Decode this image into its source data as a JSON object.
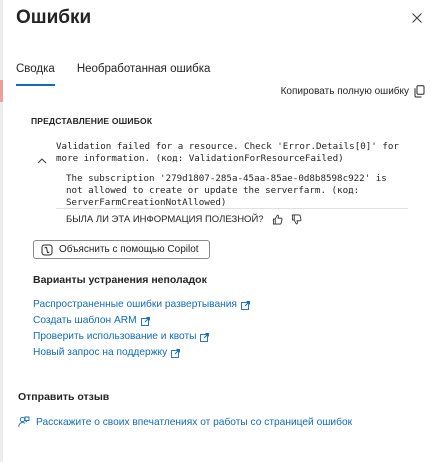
{
  "header": {
    "title": "Ошибки"
  },
  "tabs": [
    {
      "label": "Сводка",
      "active": true
    },
    {
      "label": "Необработанная ошибка",
      "active": false
    }
  ],
  "copy": {
    "label": "Копировать полную ошибку"
  },
  "error_section": {
    "heading": "ПРЕДСТАВЛЕНИЕ ОШИБОК",
    "main_message": "Validation failed for a resource. Check 'Error.Details[0]' for more information. (код: ValidationForResourceFailed)",
    "detail_message": "The subscription '279d1807-285a-45aa-85ae-0d8b8598c922' is not allowed to create or update the serverfarm. (код: ServerFarmCreationNotAllowed)"
  },
  "helpful": {
    "question": "БЫЛА ЛИ ЭТА ИНФОРМАЦИЯ ПОЛЕЗНОЙ?"
  },
  "copilot": {
    "label": "Объяснить с помощью Copilot"
  },
  "troubleshooting": {
    "title": "Варианты устранения неполадок",
    "links": [
      "Распространенные ошибки развертывания",
      "Создать шаблон ARM",
      "Проверить использование и квоты",
      "Новый запрос на поддержку"
    ]
  },
  "feedback": {
    "title": "Отправить отзыв",
    "link": "Расскажите о своих впечатлениях от работы со страницей ошибок"
  },
  "colors": {
    "accent": "#0f6cbd",
    "text": "#242424"
  }
}
